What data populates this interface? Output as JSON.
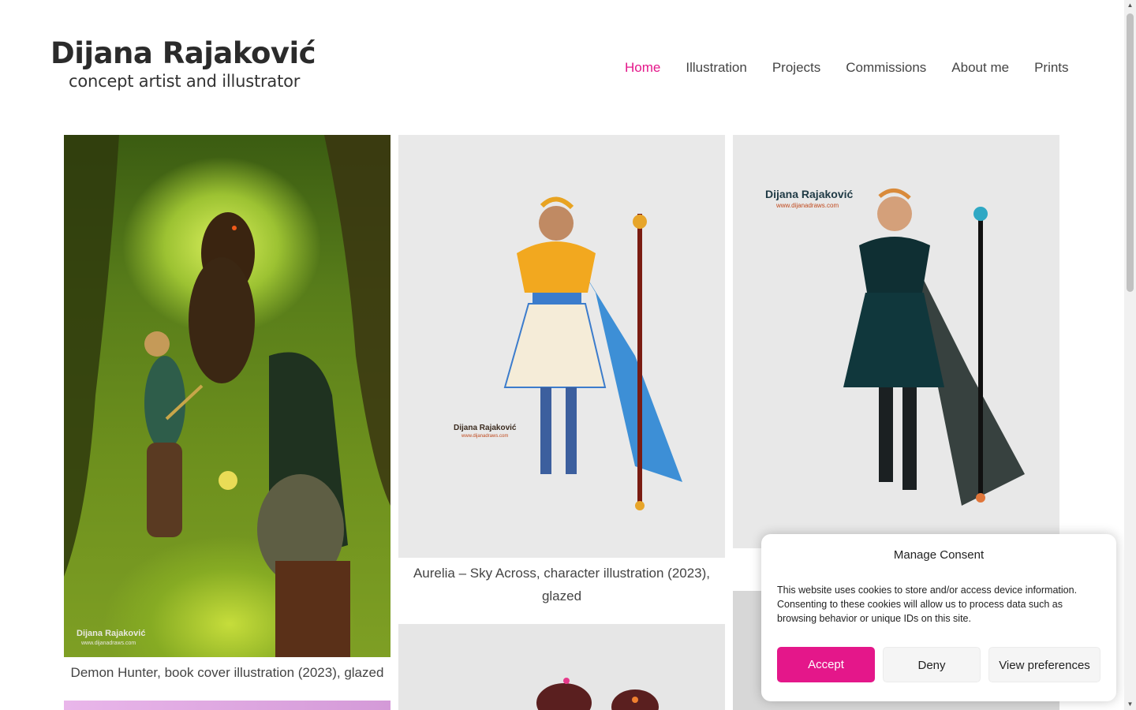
{
  "header": {
    "logo_name": "Dijana Rajaković",
    "logo_subtitle": "concept artist and illustrator"
  },
  "nav": {
    "items": [
      {
        "label": "Home",
        "active": true
      },
      {
        "label": "Illustration",
        "active": false
      },
      {
        "label": "Projects",
        "active": false
      },
      {
        "label": "Commissions",
        "active": false
      },
      {
        "label": "About me",
        "active": false
      },
      {
        "label": "Prints",
        "active": false
      }
    ]
  },
  "gallery": {
    "items": [
      {
        "caption": "Demon Hunter, book cover illustration (2023), glazed",
        "watermark": "Dijana Rajaković",
        "watermark_url": "www.dijanadraws.com"
      },
      {
        "caption": "Aurelia – Sky Across, character illustration (2023), glazed",
        "watermark": "Dijana Rajaković",
        "watermark_url": "www.dijanadraws.com"
      },
      {
        "caption": "",
        "watermark": "Dijana Rajaković",
        "watermark_url": "www.dijanadraws.com"
      }
    ]
  },
  "consent": {
    "title": "Manage Consent",
    "text": "This website uses cookies to store and/or access device information. Consenting to these cookies will allow us to process data such as browsing behavior or unique IDs on this site.",
    "accept_label": "Accept",
    "deny_label": "Deny",
    "preferences_label": "View preferences"
  },
  "colors": {
    "accent": "#e4178a",
    "text": "#444444"
  }
}
